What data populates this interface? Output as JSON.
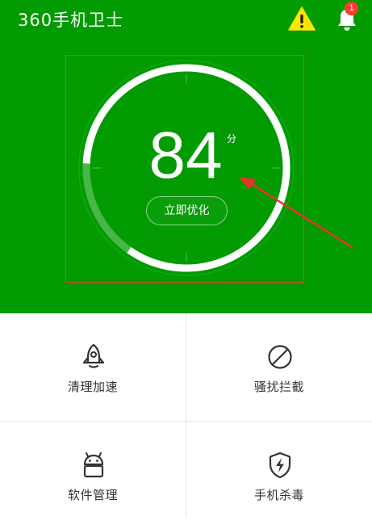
{
  "header": {
    "app_title": "360手机卫士",
    "warning_icon": "warning-triangle-icon",
    "bell_icon": "bell-icon",
    "notification_count": "1",
    "bg_color": "#029b02",
    "badge_color": "#ff3b30",
    "warning_color": "#ffe600"
  },
  "score": {
    "value": "84",
    "unit": "分",
    "level": 84,
    "max": 100,
    "optimize_label": "立即优化"
  },
  "tiles": [
    {
      "label": "清理加速",
      "icon": "rocket-icon"
    },
    {
      "label": "骚扰拦截",
      "icon": "block-icon"
    },
    {
      "label": "软件管理",
      "icon": "android-icon"
    },
    {
      "label": "手机杀毒",
      "icon": "shield-bolt-icon"
    }
  ]
}
